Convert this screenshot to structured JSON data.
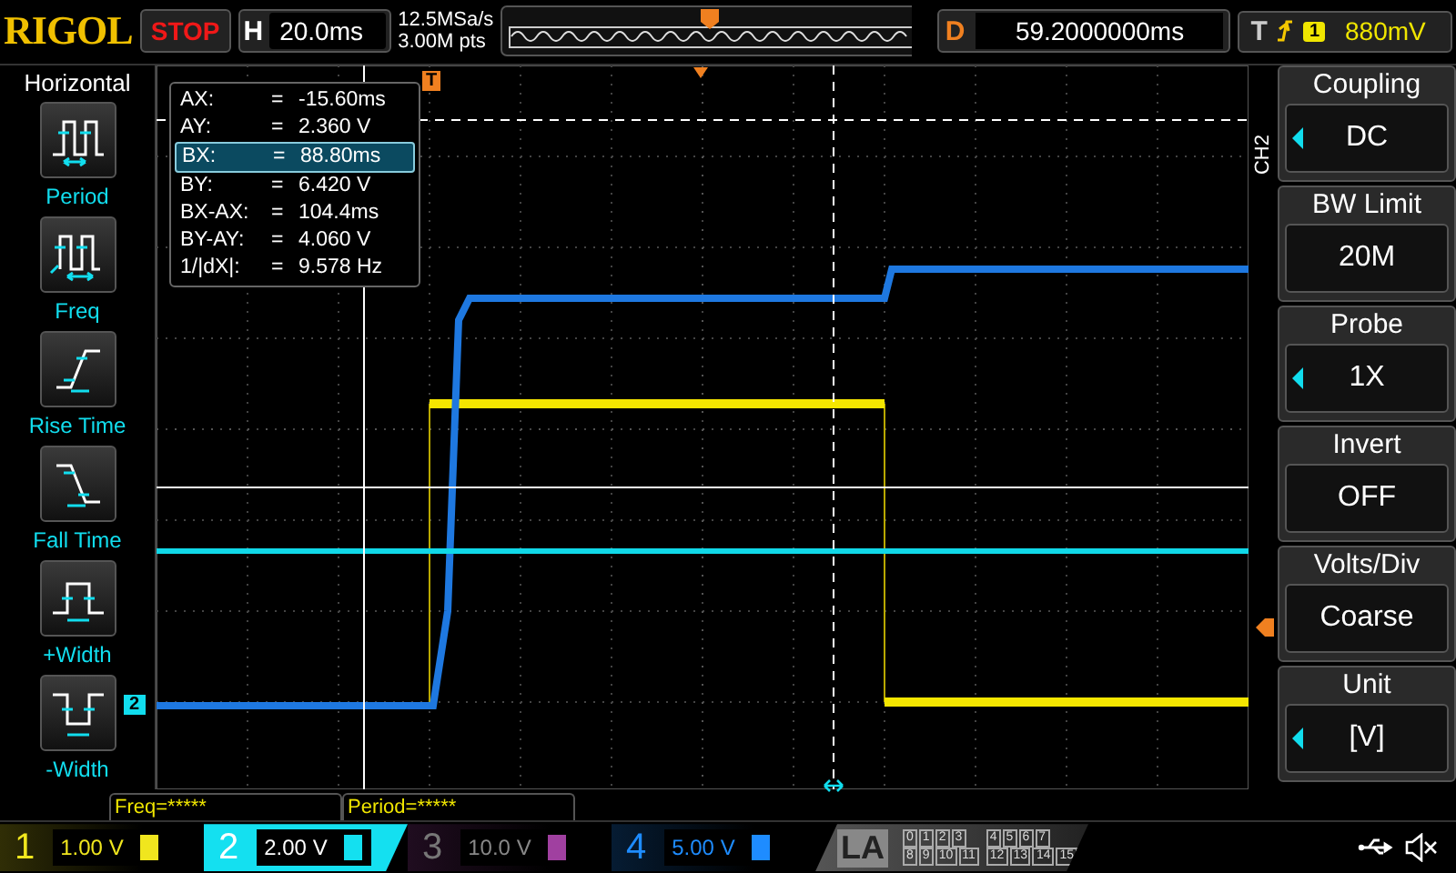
{
  "top_bar": {
    "brand": "RIGOL",
    "run_status": "STOP",
    "horizontal": {
      "label": "H",
      "value": "20.0ms"
    },
    "sample_rate": "12.5MSa/s",
    "memory_depth": "3.00M pts",
    "delay": {
      "label": "D",
      "value": "59.2000000ms"
    },
    "trigger": {
      "label": "T",
      "source": "1",
      "level": "880mV"
    }
  },
  "left_panel": {
    "title": "Horizontal",
    "items": [
      {
        "kind": "period",
        "label": "Period"
      },
      {
        "kind": "freq",
        "label": "Freq"
      },
      {
        "kind": "rise",
        "label": "Rise Time"
      },
      {
        "kind": "fall",
        "label": "Fall Time"
      },
      {
        "kind": "pwidth",
        "label": "+Width"
      },
      {
        "kind": "nwidth",
        "label": "-Width"
      }
    ]
  },
  "cursor_readout": [
    {
      "label": "AX:",
      "sign": "=",
      "value": "-15.60ms",
      "selected": false
    },
    {
      "label": "AY:",
      "sign": "=",
      "value": "2.360 V",
      "selected": false
    },
    {
      "label": "BX:",
      "sign": "=",
      "value": "88.80ms",
      "selected": true
    },
    {
      "label": "BY:",
      "sign": "=",
      "value": "6.420 V",
      "selected": false
    },
    {
      "label": "BX-AX:",
      "sign": "=",
      "value": "104.4ms",
      "selected": false
    },
    {
      "label": "BY-AY:",
      "sign": "=",
      "value": "4.060 V",
      "selected": false
    },
    {
      "label": "1/|dX|:",
      "sign": "=",
      "value": "9.578 Hz",
      "selected": false
    }
  ],
  "grid": {
    "trigger_marker": "T",
    "channel_marker": "2"
  },
  "right_menu": {
    "channel": "CH2",
    "items": [
      {
        "title": "Coupling",
        "value": "DC",
        "adjustable": true
      },
      {
        "title": "BW Limit",
        "value": "20M",
        "adjustable": false
      },
      {
        "title": "Probe",
        "value": "1X",
        "adjustable": true
      },
      {
        "title": "Invert",
        "value": "OFF",
        "adjustable": false
      },
      {
        "title": "Volts/Div",
        "value": "Coarse",
        "adjustable": false
      },
      {
        "title": "Unit",
        "value": "[V]",
        "adjustable": true
      }
    ]
  },
  "measurements": [
    "Freq=*****",
    "Period=*****"
  ],
  "channels": [
    {
      "number": "1",
      "scale": "1.00 V",
      "color": "#f0e61e",
      "enabled": true,
      "selected": false
    },
    {
      "number": "2",
      "scale": "2.00 V",
      "color": "#14e0f0",
      "enabled": true,
      "selected": true
    },
    {
      "number": "3",
      "scale": "10.0 V",
      "color": "#a040a0",
      "enabled": false,
      "selected": false
    },
    {
      "number": "4",
      "scale": "5.00 V",
      "color": "#1e8cff",
      "enabled": true,
      "selected": false
    }
  ],
  "logic": {
    "label": "LA",
    "bits": [
      [
        "0",
        "1",
        "2",
        "3"
      ],
      [
        "4",
        "5",
        "6",
        "7"
      ],
      [
        "8",
        "9",
        "10",
        "11"
      ],
      [
        "12",
        "13",
        "14",
        "15"
      ]
    ]
  }
}
